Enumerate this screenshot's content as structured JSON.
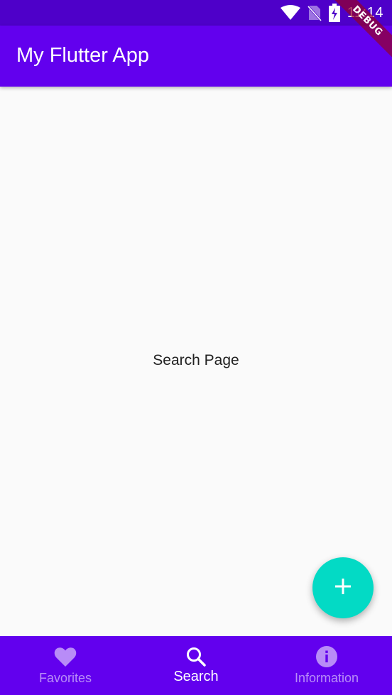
{
  "status_bar": {
    "time": "11:14",
    "icons": [
      "wifi-icon",
      "no-sim-icon",
      "battery-charging-icon"
    ]
  },
  "app_bar": {
    "title": "My Flutter App"
  },
  "debug_banner": {
    "label": "DEBUG"
  },
  "main": {
    "page_text": "Search Page"
  },
  "fab": {
    "icon": "plus-icon"
  },
  "bottom_nav": {
    "selected": "Search",
    "items": [
      {
        "label": "Favorites",
        "icon": "heart-icon",
        "active": false
      },
      {
        "label": "Search",
        "icon": "search-icon",
        "active": true
      },
      {
        "label": "Information",
        "icon": "info-icon",
        "active": false
      }
    ]
  },
  "colors": {
    "primary": "#6200ee",
    "status_bar": "#4e00c9",
    "accent": "#03dac5",
    "background": "#fafafa"
  }
}
